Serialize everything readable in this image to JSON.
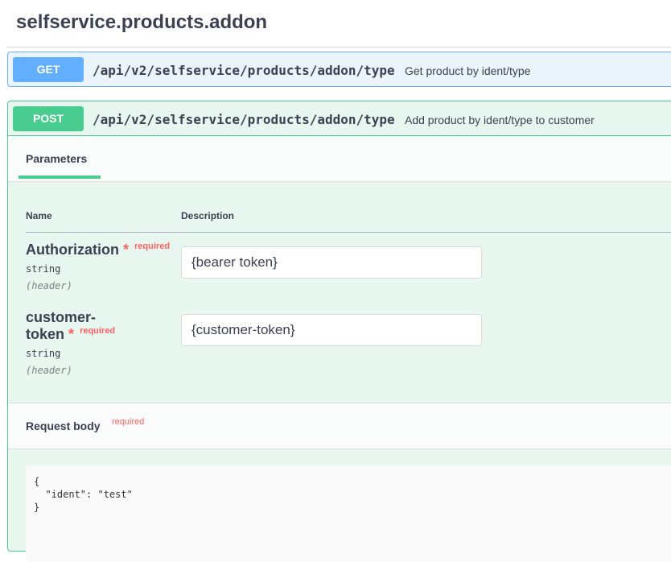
{
  "section": {
    "title": "selfservice.products.addon"
  },
  "operations": [
    {
      "method": "GET",
      "path": "/api/v2/selfservice/products/addon/type",
      "summary": "Get product by ident/type"
    },
    {
      "method": "POST",
      "path": "/api/v2/selfservice/products/addon/type",
      "summary": "Add product by ident/type to customer"
    }
  ],
  "post_panel": {
    "tab_label": "Parameters",
    "columns": {
      "name": "Name",
      "description": "Description"
    },
    "params": [
      {
        "name": "Authorization",
        "star": "*",
        "required": "required",
        "type": "string",
        "in": "(header)",
        "value": "{bearer token}"
      },
      {
        "name_line1": "customer-",
        "name_line2": "token",
        "star": "*",
        "required": "required",
        "type": "string",
        "in": "(header)",
        "value": "{customer-token}"
      }
    ],
    "request_body": {
      "label": "Request body",
      "required": "required",
      "code": "{\n  \"ident\": \"test\"\n}"
    }
  },
  "colors": {
    "get": "#61affe",
    "post": "#49cc90",
    "required": "#ff6060"
  }
}
